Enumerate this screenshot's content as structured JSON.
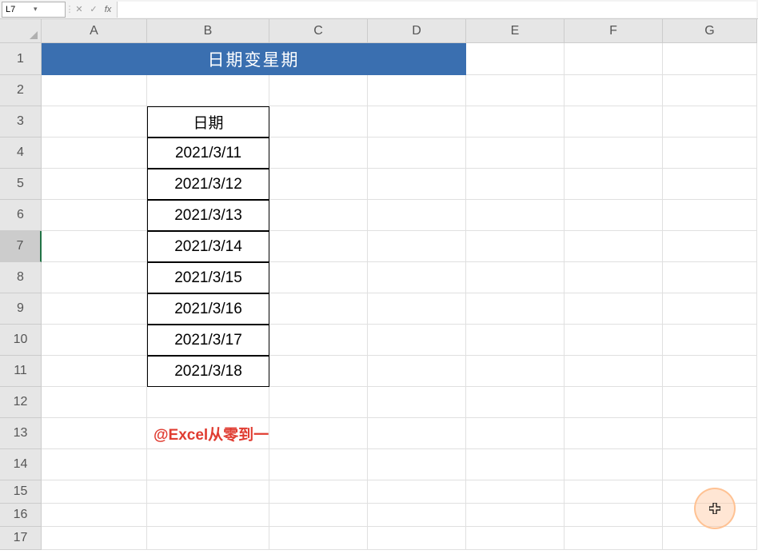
{
  "formula_bar": {
    "cell_ref": "L7",
    "cancel": "✕",
    "confirm": "✓",
    "fx": "fx",
    "value": ""
  },
  "columns": [
    "A",
    "B",
    "C",
    "D",
    "E",
    "F",
    "G"
  ],
  "rows": [
    "1",
    "2",
    "3",
    "4",
    "5",
    "6",
    "7",
    "8",
    "9",
    "10",
    "11",
    "12",
    "13",
    "14",
    "15",
    "16",
    "17"
  ],
  "title": "日期变星期",
  "table": {
    "header": "日期",
    "dates": [
      "2021/3/11",
      "2021/3/12",
      "2021/3/13",
      "2021/3/14",
      "2021/3/15",
      "2021/3/16",
      "2021/3/17",
      "2021/3/18"
    ]
  },
  "watermark": "@Excel从零到一",
  "active_row": "7",
  "colors": {
    "title_bg": "#3a6fb0",
    "watermark": "#e03c31"
  }
}
